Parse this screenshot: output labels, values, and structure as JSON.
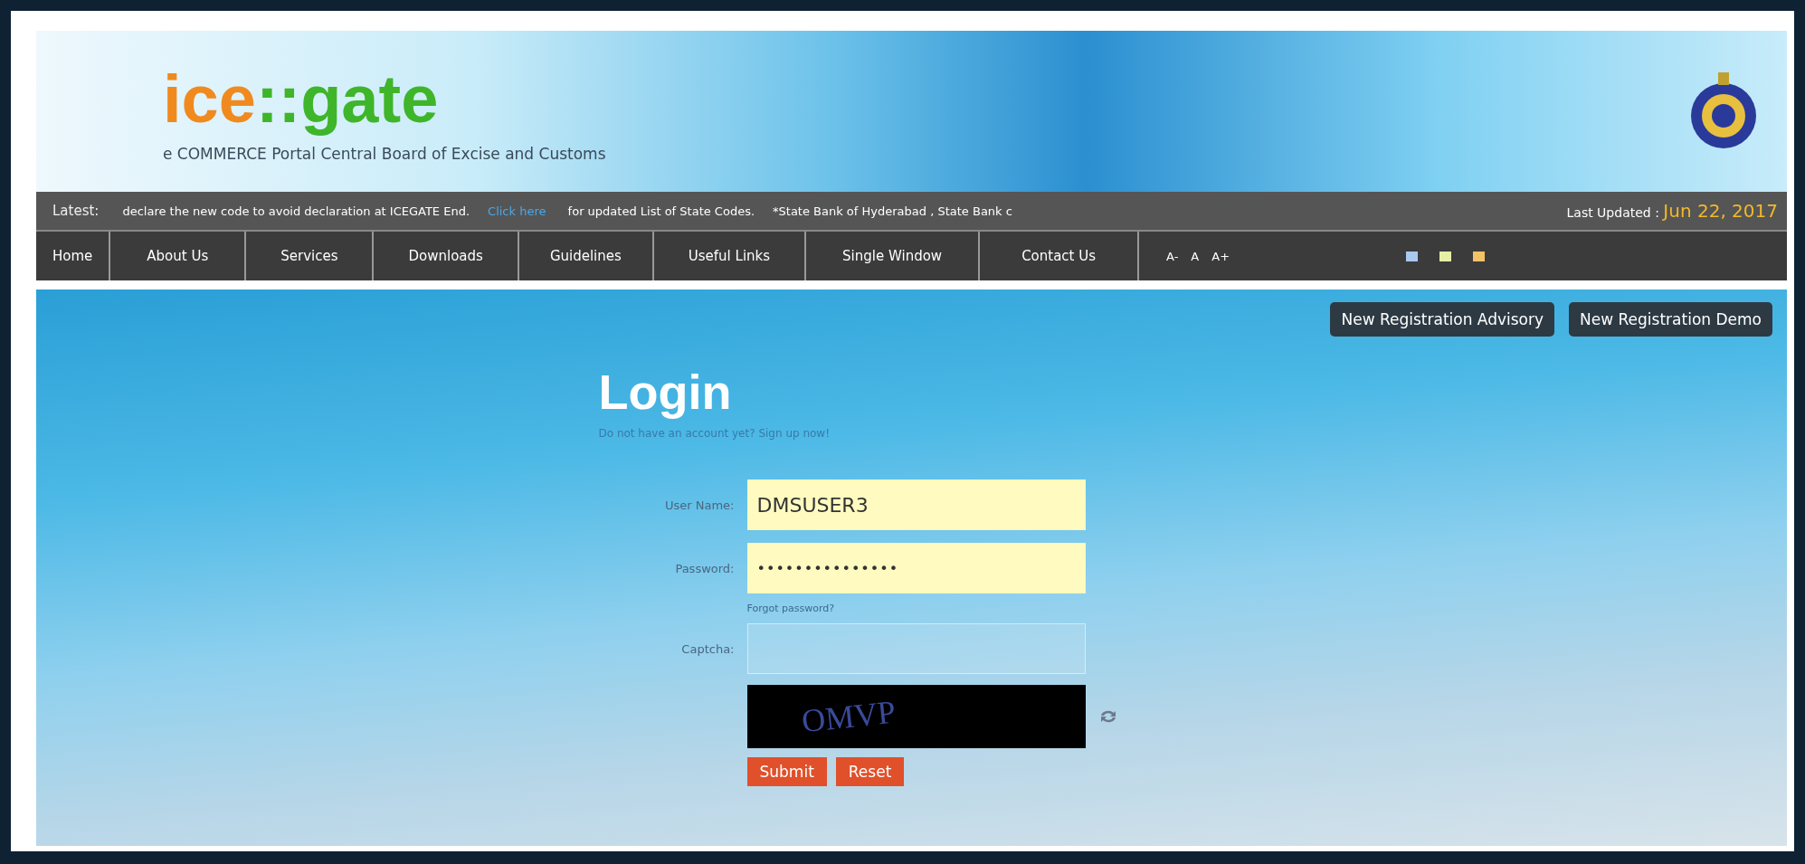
{
  "header": {
    "logo": {
      "part_1": "ice",
      "part_2": "::gate"
    },
    "tagline": "e COMMERCE Portal Central Board of Excise and Customs"
  },
  "ticker": {
    "label": "Latest:",
    "items": [
      {
        "kind": "text",
        "text": "declare the new code to avoid declaration at ICEGATE End."
      },
      {
        "kind": "link",
        "text": "Click here"
      },
      {
        "kind": "text",
        "text": " for updated List of State Codes."
      },
      {
        "kind": "text",
        "text": "*State Bank of Hyderabad , State Bank c"
      }
    ],
    "updated_label": "Last Updated :",
    "updated_date": "Jun 22, 2017"
  },
  "nav": {
    "items": [
      "Home",
      "About Us",
      "Services",
      "Downloads",
      "Guidelines",
      "Useful Links",
      "Single Window",
      "Contact Us"
    ],
    "font_sizes": [
      "A-",
      "A",
      "A+"
    ],
    "theme_swatches": [
      {
        "color": "#a9c9ef"
      },
      {
        "color": "#e6f0a6"
      },
      {
        "color": "#f2c267"
      }
    ]
  },
  "top_buttons": [
    "New Registration Advisory",
    "New Registration Demo"
  ],
  "login": {
    "title": "Login",
    "signup_text": "Do not have an account yet? Sign up now!",
    "fields": [
      {
        "kind": "text",
        "label": "User Name:",
        "value": "DMSUSER3",
        "filled": true
      },
      {
        "kind": "password",
        "label": "Password:",
        "value": "•••••••••••••••",
        "filled": true
      }
    ],
    "forgot": "Forgot password?",
    "captcha_label": "Captcha:",
    "captcha_image_text": "OMVP",
    "buttons": [
      "Submit",
      "Reset"
    ]
  }
}
